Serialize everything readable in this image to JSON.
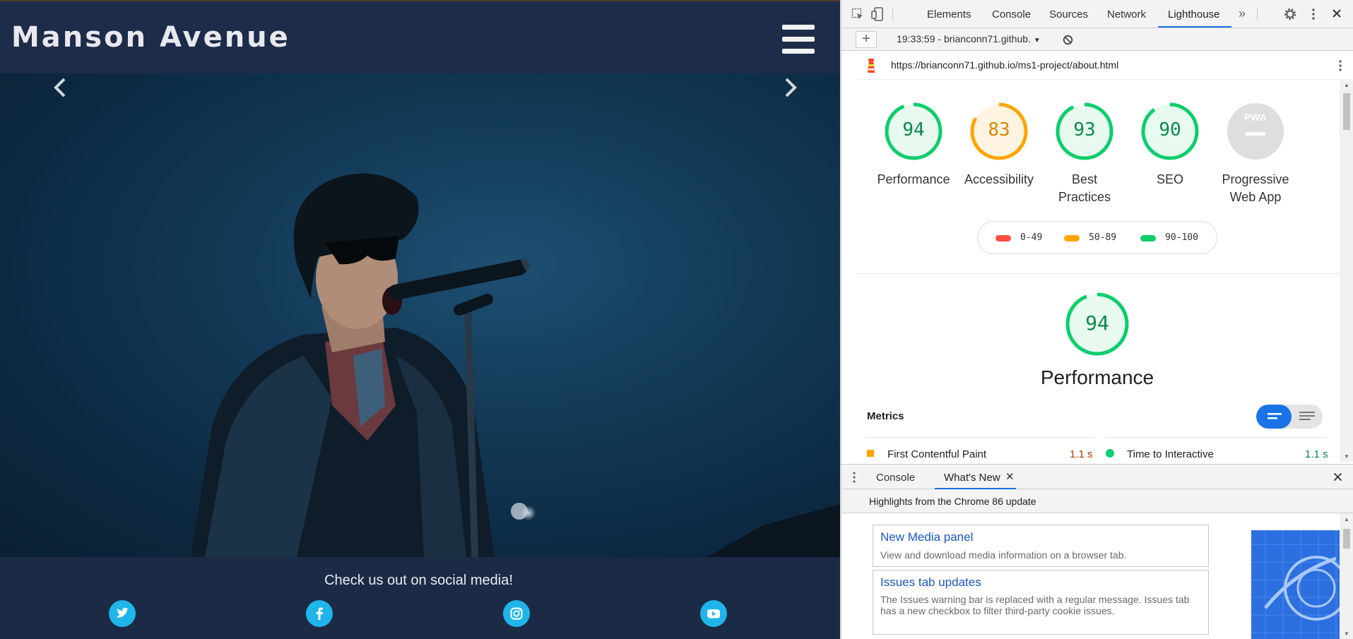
{
  "website": {
    "site_title": "Manson Avenue",
    "social_heading": "Check us out on social media!",
    "social_links": [
      {
        "name": "Twitter",
        "icon": "twitter-icon"
      },
      {
        "name": "Facebook",
        "icon": "facebook-icon"
      },
      {
        "name": "Instagram",
        "icon": "instagram-icon"
      },
      {
        "name": "YouTube",
        "icon": "youtube-icon"
      }
    ],
    "accent_color": "#1fb5ea",
    "header_color": "#1d2c48"
  },
  "devtools": {
    "tabs": [
      "Elements",
      "Console",
      "Sources",
      "Network",
      "Lighthouse"
    ],
    "active_tab": "Lighthouse",
    "more_tabs_icon": "chevron-double-right-icon",
    "lighthouse": {
      "report_selector": "19:33:59 - brianconn71.github.",
      "url": "https://brianconn71.github.io/ms1-project/about.html",
      "categories": [
        {
          "label": "Performance",
          "score": 94,
          "color": "#0cce6b"
        },
        {
          "label": "Accessibility",
          "score": 83,
          "color": "#ffa400"
        },
        {
          "label": "Best Practices",
          "score": 93,
          "color": "#0cce6b"
        },
        {
          "label": "SEO",
          "score": 90,
          "color": "#0cce6b"
        },
        {
          "label": "Progressive Web App",
          "score": null,
          "badge": "PWA"
        }
      ],
      "legend": [
        {
          "range": "0-49",
          "color": "#ff4e42"
        },
        {
          "range": "50-89",
          "color": "#ffa400"
        },
        {
          "range": "90-100",
          "color": "#0cce6b"
        }
      ],
      "performance_section": {
        "score": 94,
        "title": "Performance",
        "metrics_heading": "Metrics",
        "metrics": [
          {
            "name": "First Contentful Paint",
            "value": "1.1 s",
            "status": "average"
          },
          {
            "name": "Time to Interactive",
            "value": "1.1 s",
            "status": "pass"
          }
        ]
      }
    },
    "drawer": {
      "tabs": [
        "Console",
        "What's New"
      ],
      "active_tab": "What's New",
      "highlights": "Highlights from the Chrome 86 update",
      "items": [
        {
          "title": "New Media panel",
          "description": "View and download media information on a browser tab."
        },
        {
          "title": "Issues tab updates",
          "description": "The Issues warning bar is replaced with a regular message. Issues tab has a new checkbox to filter third-party cookie issues."
        }
      ]
    }
  }
}
